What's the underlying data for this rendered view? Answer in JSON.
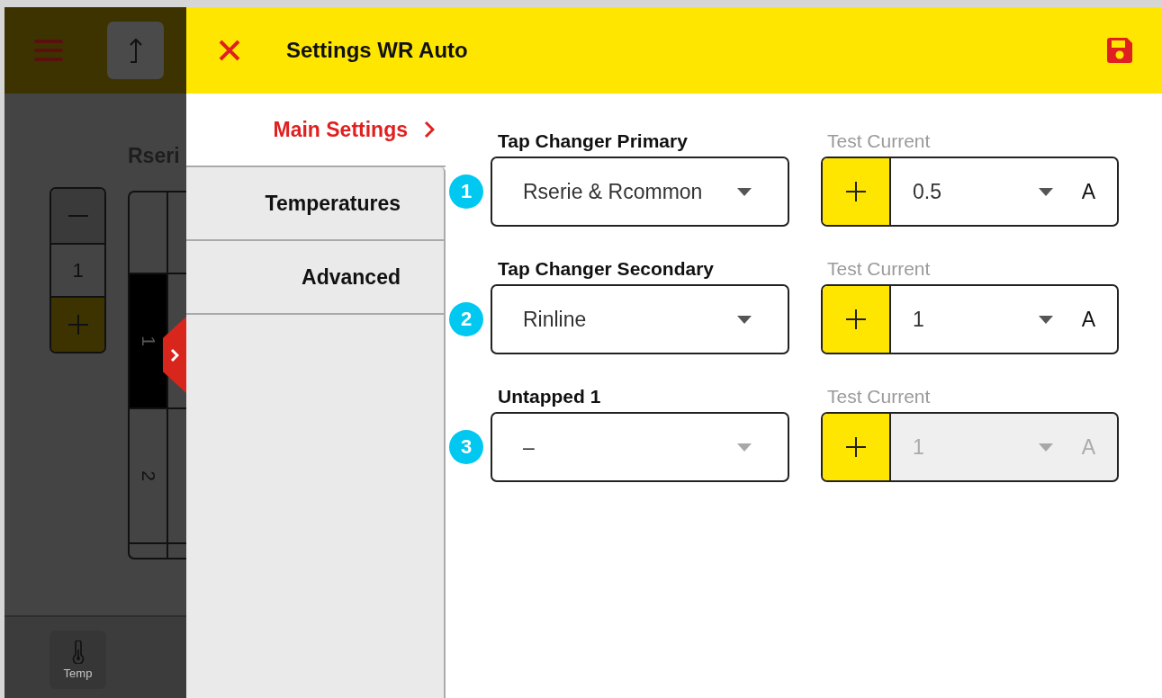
{
  "background_app": {
    "heading": "Rseri",
    "stepper_value": "1",
    "grid_rows": [
      {
        "label": "1",
        "selected": true
      },
      {
        "label": "2",
        "selected": false
      }
    ],
    "bottom_bar": [
      {
        "label": "Temp"
      }
    ]
  },
  "dialog": {
    "title": "Settings WR Auto",
    "tabs": [
      {
        "label": "Main Settings",
        "selected": true
      },
      {
        "label": "Temperatures",
        "selected": false
      },
      {
        "label": "Advanced",
        "selected": false
      }
    ],
    "rows": [
      {
        "number": "1",
        "label": "Tap Changer Primary",
        "value": "Rserie & Rcommon",
        "current_label": "Test Current",
        "current": "0.5",
        "unit": "A",
        "disabled": false
      },
      {
        "number": "2",
        "label": "Tap Changer Secondary",
        "value": "Rinline",
        "current_label": "Test Current",
        "current": "1",
        "unit": "A",
        "disabled": false
      },
      {
        "number": "3",
        "label": "Untapped 1",
        "value": "–",
        "current_label": "Test Current",
        "current": "1",
        "unit": "A",
        "disabled": true
      }
    ]
  }
}
